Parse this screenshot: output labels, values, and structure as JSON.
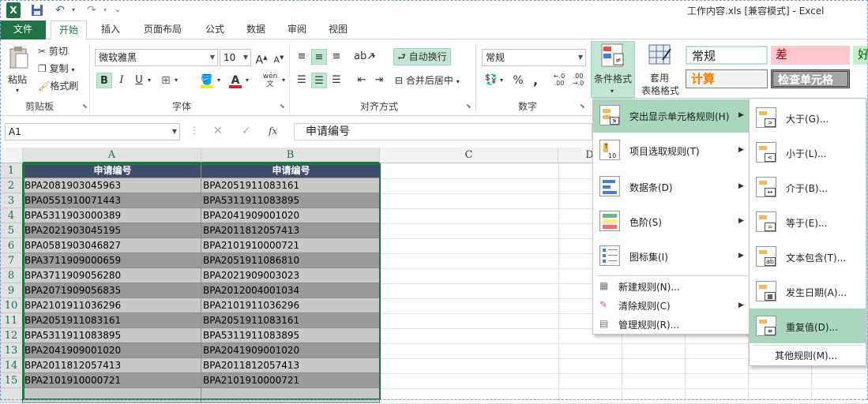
{
  "window": {
    "title": "工作内容.xls  [兼容模式] - Excel"
  },
  "quick_access": {
    "excel_icon": "X",
    "save_icon": "save-icon",
    "undo_icon": "undo-icon",
    "redo_icon": "redo-icon"
  },
  "tabs": [
    "文件",
    "开始",
    "插入",
    "页面布局",
    "公式",
    "数据",
    "审阅",
    "视图"
  ],
  "ribbon": {
    "clipboard": {
      "paste": "粘贴",
      "cut": "剪切",
      "copy": "复制",
      "format_painter": "格式刷",
      "label": "剪贴板"
    },
    "font": {
      "name": "微软雅黑",
      "size": "10",
      "bold": "B",
      "italic": "I",
      "underline": "U",
      "grow": "A",
      "shrink": "A",
      "phonetic": "wén",
      "label": "字体"
    },
    "align": {
      "wrap": "自动换行",
      "merge": "合并后居中",
      "label": "对齐方式"
    },
    "number": {
      "format": "常规",
      "percent": "%",
      "comma": ",",
      "label": "数字"
    },
    "styles": {
      "cond_format": "条件格式",
      "table_format_1": "套用",
      "table_format_2": "表格格式",
      "normal": "常规",
      "bad": "差",
      "good": "好",
      "calc": "计算",
      "check": "检查单元格"
    }
  },
  "formula_bar": {
    "name_box": "A1",
    "cancel": "✕",
    "enter": "✓",
    "fx": "fx",
    "value": "申请编号"
  },
  "sheet": {
    "columns": [
      "A",
      "B",
      "C",
      "D"
    ],
    "rows": [
      "1",
      "2",
      "3",
      "4",
      "5",
      "6",
      "7",
      "8",
      "9",
      "10",
      "11",
      "12",
      "13",
      "14",
      "15"
    ],
    "header": [
      "申请编号",
      "申请编号"
    ],
    "col_a": [
      "BPA2081903045963",
      "BPA0551910071443",
      "BPA5311903000389",
      "BPA2021903045195",
      "BPA0581903046827",
      "BPA3711909000659",
      "BPA3711909056280",
      "BPA2071909056835",
      "BPA2101911036296",
      "BPA2051911083161",
      "BPA5311911083895",
      "BPA2041909001020",
      "BPA2011812057413",
      "BPA2101910000721"
    ],
    "col_b": [
      "BPA2051911083161",
      "BPA5311911083895",
      "BPA2041909001020",
      "BPA2011812057413",
      "BPA2101910000721",
      "BPA2051911086810",
      "BPA2021909003023",
      "BPA2012004001034",
      "BPA2101911036296",
      "BPA2051911083161",
      "BPA5311911083895",
      "BPA2041909001020",
      "BPA2011812057413",
      "BPA2101910000721"
    ]
  },
  "cond_menu": {
    "items": [
      "突出显示单元格规则(H)",
      "项目选取规则(T)",
      "数据条(D)",
      "色阶(S)",
      "图标集(I)"
    ],
    "small_items": [
      "新建规则(N)...",
      "清除规则(C)",
      "管理规则(R)..."
    ]
  },
  "highlight_submenu": {
    "items": [
      "大于(G)...",
      "小于(L)...",
      "介于(B)...",
      "等于(E)...",
      "文本包含(T)...",
      "发生日期(A)...",
      "重复值(D)..."
    ],
    "more": "其他规则(M)..."
  },
  "colors": {
    "excel_green": "#217346",
    "header_fill": "#3e4d6a",
    "row_light": "#c8c8c8",
    "row_dark": "#9a9a9a",
    "menu_highlight": "#a8d5bb"
  }
}
